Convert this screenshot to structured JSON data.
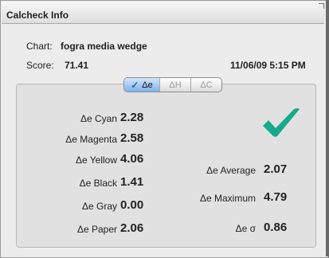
{
  "window": {
    "title": "Calcheck Info"
  },
  "info": {
    "chart_label": "Chart:",
    "chart_value": "fogra media wedge",
    "score_label": "Score:",
    "score_value": "71.41",
    "timestamp": "11/06/09 5:15 PM"
  },
  "tabs": [
    {
      "label": "Δe",
      "active": true
    },
    {
      "label": "ΔH",
      "active": false
    },
    {
      "label": "ΔC",
      "active": false
    }
  ],
  "left_metrics": [
    {
      "label": "Δe Cyan",
      "value": "2.28"
    },
    {
      "label": "Δe Magenta",
      "value": "2.58"
    },
    {
      "label": "Δe Yellow",
      "value": "4.06"
    },
    {
      "label": "Δe Black",
      "value": "1.41"
    },
    {
      "label": "Δe Gray",
      "value": "0.00"
    },
    {
      "label": "Δe Paper",
      "value": "2.06"
    }
  ],
  "right_metrics": [
    {
      "label": "Δe Average",
      "value": "2.07"
    },
    {
      "label": "Δe Maximum",
      "value": "4.79"
    },
    {
      "label": "Δe σ",
      "value": "0.86"
    }
  ],
  "colors": {
    "pass_check": "#17a98c",
    "active_tab": "#7fb1ea"
  },
  "icons": {
    "status": "checkmark-icon",
    "tab_active": "checkmark-icon"
  }
}
